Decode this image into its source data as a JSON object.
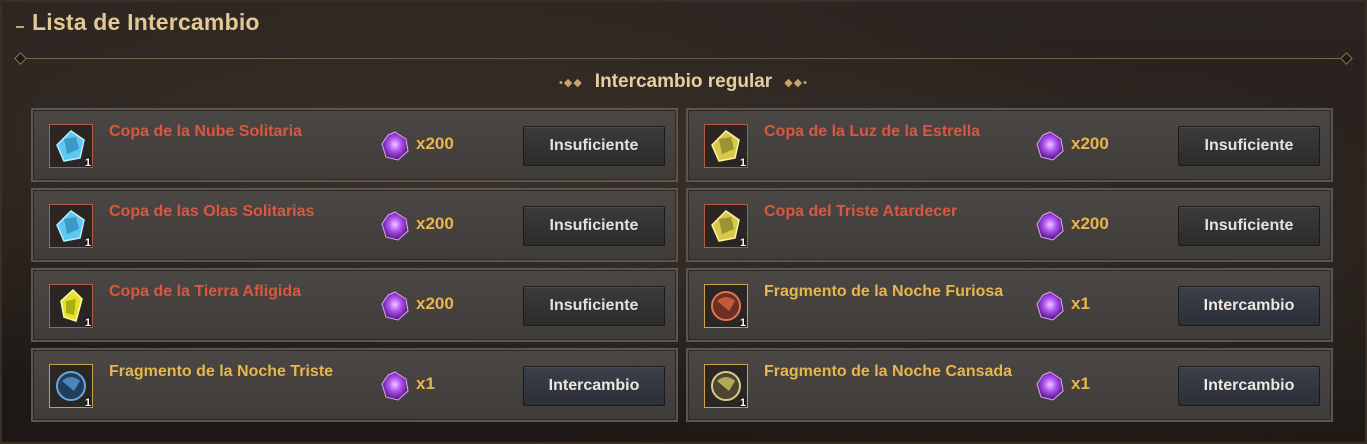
{
  "window": {
    "title": "Lista de Intercambio"
  },
  "section": {
    "label": "Intercambio regular"
  },
  "items": [
    {
      "name": "Copa de la Nube Solitaria",
      "qty": "1",
      "cost": "x200",
      "button": "Insuficiente",
      "name_color": "red",
      "icon": "blue-gem-icon"
    },
    {
      "name": "Copa de la Luz de la Estrella",
      "qty": "1",
      "cost": "x200",
      "button": "Insuficiente",
      "name_color": "red",
      "icon": "yellow-gem-icon"
    },
    {
      "name": "Copa de las Olas Solitarias",
      "qty": "1",
      "cost": "x200",
      "button": "Insuficiente",
      "name_color": "red",
      "icon": "blue-gem-icon"
    },
    {
      "name": "Copa del Triste Atardecer",
      "qty": "1",
      "cost": "x200",
      "button": "Insuficiente",
      "name_color": "red",
      "icon": "yellow-gem-icon"
    },
    {
      "name": "Copa de la Tierra Afligida",
      "qty": "1",
      "cost": "x200",
      "button": "Insuficiente",
      "name_color": "red",
      "icon": "yellow-crystal-icon"
    },
    {
      "name": "Fragmento de la Noche Furiosa",
      "qty": "1",
      "cost": "x1",
      "button": "Intercambio",
      "name_color": "gold",
      "icon": "red-orb-fragment-icon"
    },
    {
      "name": "Fragmento de la Noche Triste",
      "qty": "1",
      "cost": "x1",
      "button": "Intercambio",
      "name_color": "gold",
      "icon": "blue-orb-fragment-icon"
    },
    {
      "name": "Fragmento de la Noche Cansada",
      "qty": "1",
      "cost": "x1",
      "button": "Intercambio",
      "name_color": "gold",
      "icon": "gold-orb-fragment-icon"
    }
  ],
  "colors": {
    "red_name": "#d9583f",
    "gold_name": "#e8b64a",
    "cost_gem": "#9b3cf0"
  }
}
